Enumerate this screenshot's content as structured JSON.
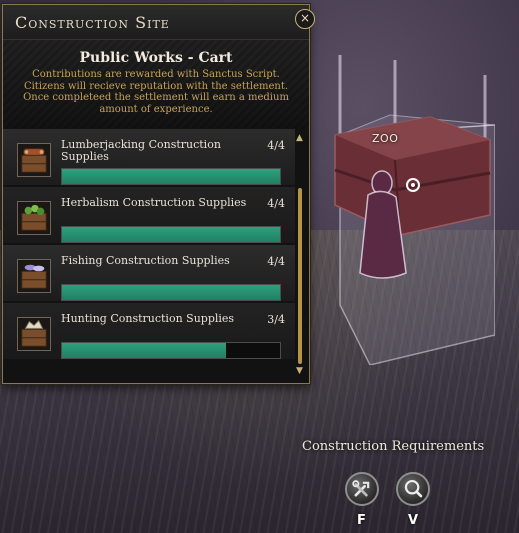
{
  "panel": {
    "title": "Construction Site",
    "subtitle": "Public Works - Cart",
    "description": "Contributions are rewarded with Sanctus Script. Citizens will recieve reputation with the settlement. Once completeed the settlement will earn a medium amount of experience.",
    "close_icon": "×"
  },
  "supplies": [
    {
      "label": "Lumberjacking Construction Supplies",
      "count": "4/4",
      "progress": 1.0,
      "icon": "log-crate-icon"
    },
    {
      "label": "Herbalism Construction Supplies",
      "count": "4/4",
      "progress": 1.0,
      "icon": "herb-crate-icon"
    },
    {
      "label": "Fishing Construction Supplies",
      "count": "4/4",
      "progress": 1.0,
      "icon": "fish-crate-icon"
    },
    {
      "label": "Hunting Construction Supplies",
      "count": "3/4",
      "progress": 0.75,
      "icon": "hide-crate-icon"
    }
  ],
  "scroll": {
    "up": "▲",
    "down": "▼"
  },
  "world": {
    "player_name": "ZOO"
  },
  "requirements": {
    "title": "Construction Requirements",
    "buttons": [
      {
        "icon": "build-tools-icon",
        "key": "F"
      },
      {
        "icon": "inspect-icon",
        "key": "V"
      }
    ]
  },
  "colors": {
    "progress": "#1f7f63",
    "accent": "#c9a35a",
    "border": "#8a7a4e"
  }
}
